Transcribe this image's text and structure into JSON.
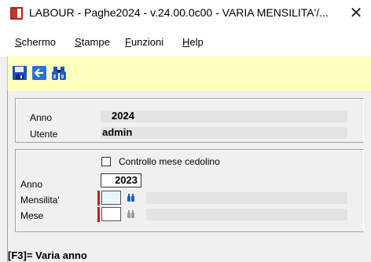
{
  "window": {
    "title": "LABOUR - Paghe2024 - v.24.00.0c00 - VARIA MENSILITA'/...",
    "close_glyph": "✕"
  },
  "menu": [
    {
      "accel": "S",
      "rest": "chermo"
    },
    {
      "accel": "S",
      "rest": "tampe"
    },
    {
      "accel": "F",
      "rest": "unzioni"
    },
    {
      "accel": "H",
      "rest": "elp"
    }
  ],
  "toolbar": {
    "icons": [
      "save-icon",
      "back-arrow-icon",
      "binoculars-icon"
    ]
  },
  "panel_top": {
    "anno_label": "Anno",
    "anno_value": "2024",
    "utente_label": "Utente",
    "utente_value": "admin"
  },
  "panel_bottom": {
    "checkbox_label": "Controllo mese cedolino",
    "checkbox_checked": false,
    "anno_label": "Anno",
    "anno_value": "2023",
    "mensilita_label": "Mensilita'",
    "mensilita_value": "",
    "mese_label": "Mese",
    "mese_value": ""
  },
  "status_text": "[F3]= Varia anno",
  "colors": {
    "toolbar_bg": "#ffffc0",
    "required_marker": "#d01818",
    "binoculars_active": "#1f5fbf",
    "binoculars_inactive": "#9a9a9a"
  }
}
